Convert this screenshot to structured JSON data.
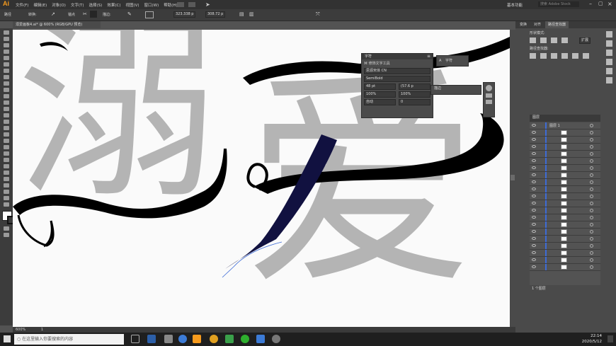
{
  "app": {
    "logo": "Ai",
    "workspace": "基本功能",
    "search_placeholder": "搜索 Adobe Stock"
  },
  "menu": [
    "文件(F)",
    "编辑(E)",
    "对象(O)",
    "文字(T)",
    "选择(S)",
    "效果(C)",
    "视图(V)",
    "窗口(W)",
    "帮助(H)"
  ],
  "control_bar": {
    "selection_label": "路径",
    "stroke_label": "描边:",
    "style_label": "转换:",
    "anchor_label": "锚点",
    "width_value": "323.338 p",
    "height_value": "308.72 p"
  },
  "document_tab": {
    "title": "溺爱画板4.ai* @ 600% (RGB/GPU 预览)"
  },
  "canvas_text": {
    "char1": "溺",
    "char2": "爱"
  },
  "character_panel": {
    "title": "字符",
    "touch_tool_label": "修饰文字工具",
    "font_family": "思源宋体 CN",
    "font_style": "SemiBold",
    "font_size": "48 pt",
    "leading": "(57.6 p",
    "h_scale": "100%",
    "v_scale": "100%",
    "kerning": "自动",
    "tracking": "0"
  },
  "char_chip": {
    "label": "字符"
  },
  "stroke_mini": {
    "label": "描边"
  },
  "right_panel": {
    "tabs": [
      "变换",
      "对齐",
      "路径查找器"
    ],
    "shape_modes_label": "形状模式:",
    "pathfinder_label": "路径查找器:",
    "expand_label": "扩展",
    "layers_tab": "图层",
    "top_layer": "图层 1",
    "layers_footer": "1 个图层"
  },
  "status": {
    "zoom": "600%",
    "page": "1"
  },
  "taskbar": {
    "search_placeholder": "在这里输入你要搜索的内容",
    "time": "22:14",
    "date": "2020/5/12"
  },
  "colors": {
    "accent": "#f79b1d",
    "layer_blue": "#3d6bd6",
    "glyph_gray": "#b4b4b4"
  }
}
